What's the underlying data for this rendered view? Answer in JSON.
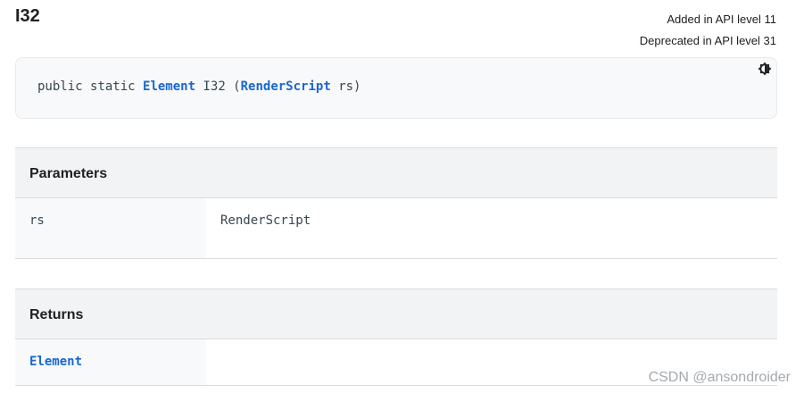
{
  "title": "I32",
  "api": {
    "added": "Added in API level 11",
    "deprecated": "Deprecated in API level 31"
  },
  "signature": {
    "prefix": "public static ",
    "return_type": "Element",
    "name": " I32 (",
    "param_type": "RenderScript",
    "param_name": " rs)"
  },
  "theme_toggle_icon": "dark-mode-toggle-icon",
  "parameters": {
    "heading": "Parameters",
    "rows": [
      {
        "name": "rs",
        "description": "RenderScript"
      }
    ]
  },
  "returns": {
    "heading": "Returns",
    "type": "Element",
    "description": ""
  },
  "watermark": "CSDN @ansondroider",
  "colors": {
    "link": "#1967d2",
    "code_bg": "#f8f9fa",
    "header_bg": "#f1f3f4",
    "border": "#dadce0"
  }
}
